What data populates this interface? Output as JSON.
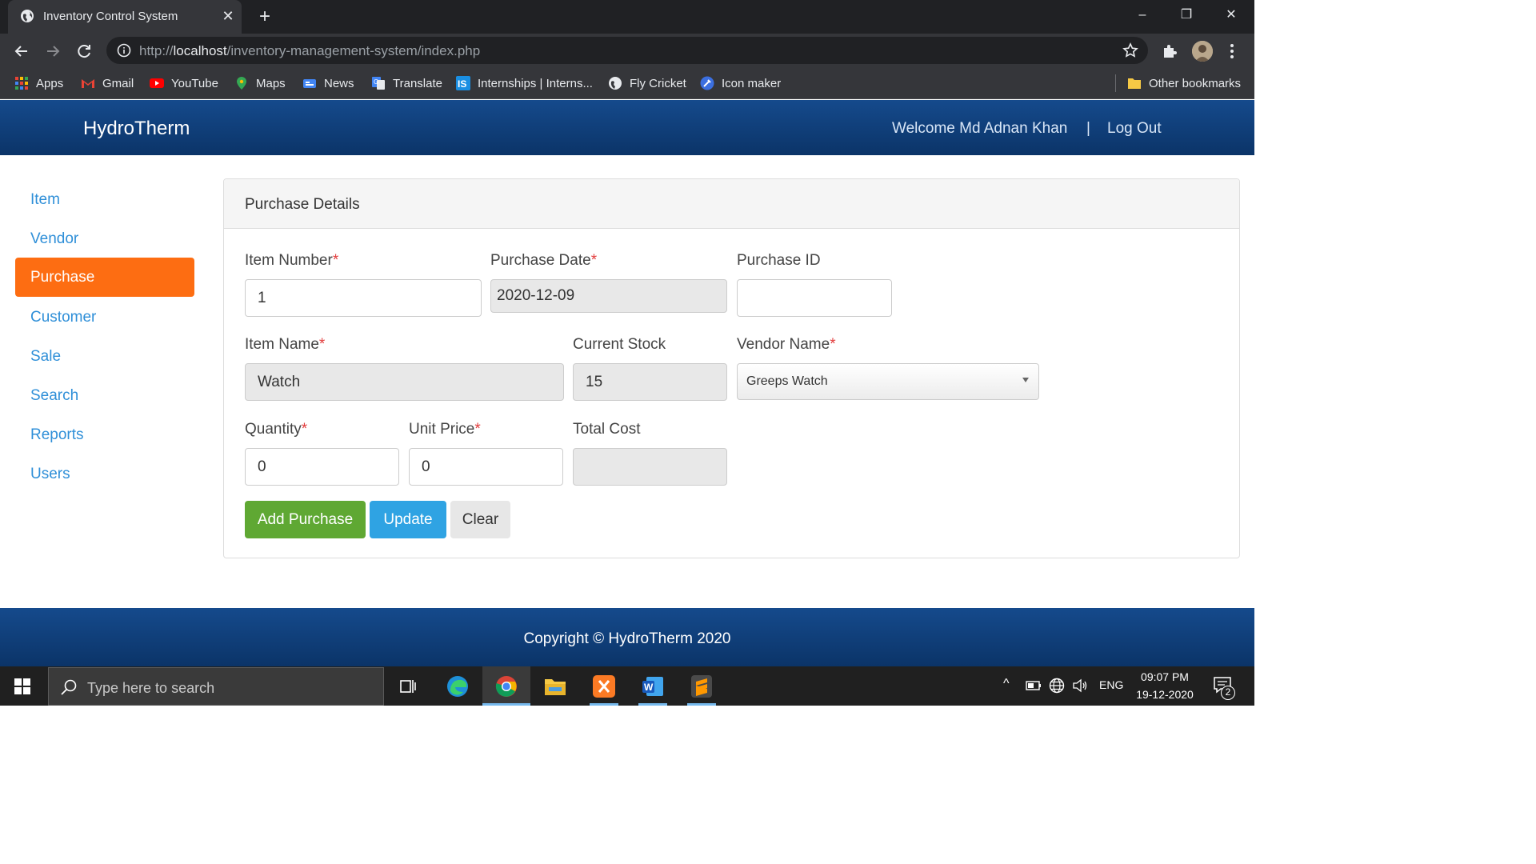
{
  "browser": {
    "tab_title": "Inventory Control System",
    "url_prefix": "http://",
    "url_host": "localhost",
    "url_path": "/inventory-management-system/index.php",
    "bookmarks": [
      {
        "label": "Apps",
        "icon": "apps-grid-icon"
      },
      {
        "label": "Gmail",
        "icon": "gmail-icon"
      },
      {
        "label": "YouTube",
        "icon": "youtube-icon"
      },
      {
        "label": "Maps",
        "icon": "maps-pin-icon"
      },
      {
        "label": "News",
        "icon": "news-icon"
      },
      {
        "label": "Translate",
        "icon": "translate-icon"
      },
      {
        "label": "Internships | Interns...",
        "icon": "internshala-icon"
      },
      {
        "label": "Fly Cricket",
        "icon": "globe-icon"
      },
      {
        "label": "Icon maker",
        "icon": "icon-maker-icon"
      }
    ],
    "other_bookmarks": "Other bookmarks"
  },
  "header": {
    "brand": "HydroTherm",
    "welcome": "Welcome Md Adnan Khan",
    "separator": "|",
    "logout": "Log Out"
  },
  "sidebar": {
    "items": [
      {
        "label": "Item",
        "active": false
      },
      {
        "label": "Vendor",
        "active": false
      },
      {
        "label": "Purchase",
        "active": true
      },
      {
        "label": "Customer",
        "active": false
      },
      {
        "label": "Sale",
        "active": false
      },
      {
        "label": "Search",
        "active": false
      },
      {
        "label": "Reports",
        "active": false
      },
      {
        "label": "Users",
        "active": false
      }
    ]
  },
  "form": {
    "title": "Purchase Details",
    "required_mark": "*",
    "item_number_label": "Item Number",
    "item_number_value": "1",
    "purchase_date_label": "Purchase Date",
    "purchase_date_value": "2020-12-09",
    "purchase_id_label": "Purchase ID",
    "purchase_id_value": "",
    "item_name_label": "Item Name",
    "item_name_value": "Watch",
    "current_stock_label": "Current Stock",
    "current_stock_value": "15",
    "vendor_name_label": "Vendor Name",
    "vendor_name_value": "Greeps Watch",
    "quantity_label": "Quantity",
    "quantity_value": "0",
    "unit_price_label": "Unit Price",
    "unit_price_value": "0",
    "total_cost_label": "Total Cost",
    "total_cost_value": "",
    "add_button": "Add Purchase",
    "update_button": "Update",
    "clear_button": "Clear"
  },
  "footer": {
    "copyright": "Copyright © HydroTherm 2020"
  },
  "taskbar": {
    "search_placeholder": "Type here to search",
    "language": "ENG",
    "time": "09:07 PM",
    "date": "19-12-2020",
    "notifications": "2"
  },
  "colors": {
    "header_blue": "#154a8c",
    "active_orange": "#fd6d12",
    "link_blue": "#2f8fd8",
    "add_green": "#5fa833",
    "update_blue": "#2fa3e3"
  }
}
